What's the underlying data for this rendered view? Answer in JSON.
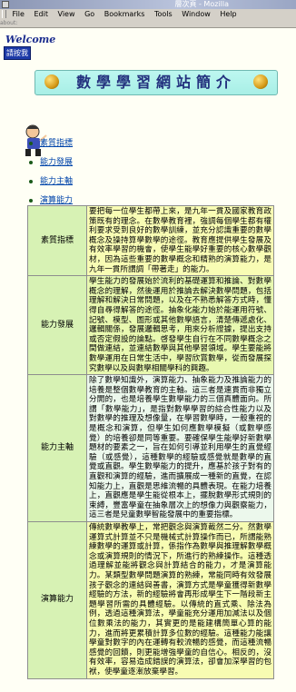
{
  "window": {
    "title": "層次頁 - Mozilla"
  },
  "menu": [
    {
      "label": "File",
      "key": "file"
    },
    {
      "label": "Edit",
      "key": "edit"
    },
    {
      "label": "View",
      "key": "view"
    },
    {
      "label": "Go",
      "key": "go"
    },
    {
      "label": "Bookmarks",
      "key": "bookmarks"
    },
    {
      "label": "Tools",
      "key": "tools"
    },
    {
      "label": "Window",
      "key": "window"
    },
    {
      "label": "Help",
      "key": "help"
    }
  ],
  "location": "about:",
  "header": {
    "welcome": "Welcome",
    "welcome_button": "請按我",
    "banner_title": "數學學習網站簡介"
  },
  "nav": [
    {
      "label": "素質指標"
    },
    {
      "label": "能力發展"
    },
    {
      "label": "能力主軸"
    },
    {
      "label": "演算能力"
    }
  ],
  "table": {
    "rows": [
      {
        "label": "素質指標",
        "text": "要把每一位學生都帶上來，是九年一貫及國家教育政策既有的理念。在數學教育裡，強調每個學生都有權利要求受到良好的數學訓練，並充分認識重要的數學概念及操持算學數學的途徑。教育應提供學生發展及有效率學習的機會，使學生能學好重要的核心數學觀材，因為這些重要的數學概念和精熟的演算能力，是九年一貫所謂調「帶著走」的能力。"
      },
      {
        "label": "能力發展",
        "text": "學生能力的發展始於流利的基礎運算和推論、對數學概念的理解，然後運用於推論去解決數學問題，包括理解和解決日常問題，以及在不熟悉解答方式時，懂得自尋得解答的途徑。抽象化能力始於能運用符號、記號、模型、圖形或其他數學語言，清楚傳遞處化、邏輯關係，發展邏輯思考，用來分析證據，提出支持或否定假設的論點。啓發學生自行在不同數學概念之間做連結，並連結數學與其他學習領域。學生要能將數學運用在日常生活中，學習欣賞數學，從而發展探究數學以及與數學相關學科的興趣。"
      },
      {
        "label": "能力主軸",
        "text": "除了數學知識外，演算能力、抽象能力及推論能力的培養是整個數學教育的主軸。這三者是連貫而非獨立分開的，也是培養學生數學能力的三個真體面向。所謂「數學能力」，是指對數學學習的綜合性能力以及對數學的推理及想像量，在學習數學時，一般重視的是概念和演算，但學生如何應數學模擬（或數學感覺）的培養卻是同等重要。要確保學生能學好新數學題材的要素之一，旨在如何引導並利用學生的直覺經驗（或感覺），這種數學的經驗或感覺就是數學的直覺或直觀。學生數學能力的提升，應基於孩子對有的直觀和演算的經驗，進而擴展成一種新的直覺，在認知能力上，直觀是思維流暢的具體表現。在能力培養上，直觀應是學生能從根本上，擺脫數學形式規則的束縛，豐富學童在抽象層次上的想像力與觀察能力，這三者是兒童數學智能發展中的重要指標。"
      },
      {
        "label": "演算能力",
        "text": "傳統數學教學上，常把觀念與演算截然二分。然數學運算式計算並不只是機械式計算操作而已，所謂能熟練數學的運算或計算，係指作為數學與推理解數學概念或演算規則的情況下，所進行的熟練操作。這種透過理解並能將觀念與計算結合的能力，才是演算能力。某類型數學問題演算的熟練，常能同時有效發展孩子觀念的連結與善書，演算方式是學童獲得新數學經驗的方法，新的經驗將會再形成學生下一階段新主題學習所需的具體經驗。以傳統的直式乘、除法為例，透過這種演算法，學童能充分運用加減法以及個位數乘法的能力，其實更的是能建構簡單心算的能力，進而將更累積計算多位數的經驗。這種能力能讓學童對數字的內在運轉有較流暢的感覺，而這種流暢感覺的回饋，則更能增強學童的自信心。相反的，沒有效率，容易造成錯誤的演算法，卻會加深學習的包袱，使學童逐漸放棄學習。"
      }
    ]
  }
}
